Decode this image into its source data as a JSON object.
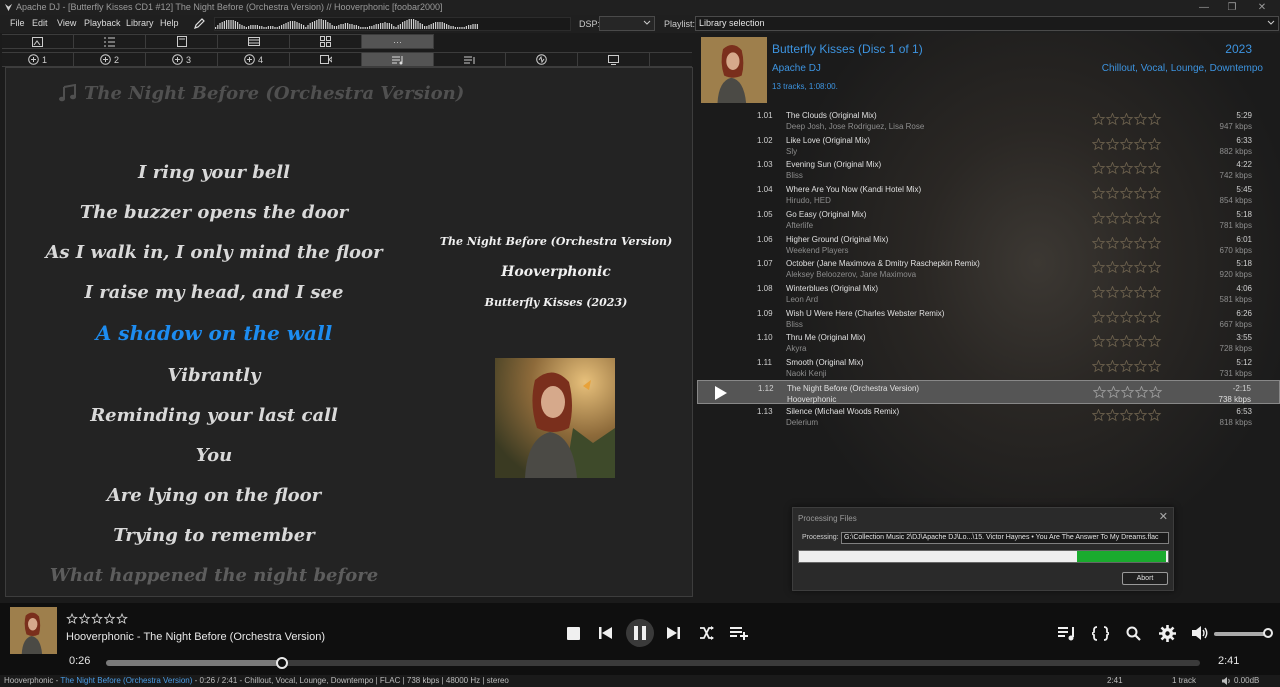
{
  "window": {
    "title": "Apache DJ - [Butterfly Kisses CD1 #12] The Night Before (Orchestra Version) // Hooverphonic  [foobar2000]"
  },
  "menu": [
    "File",
    "Edit",
    "View",
    "Playback",
    "Library",
    "Help"
  ],
  "toolbar": {
    "dsp_label": "DSP:",
    "dsp_value": "",
    "playlist_label": "Playlist:",
    "playlist_value": "Library selection"
  },
  "top_tabs": [
    "image-icon",
    "list-icon",
    "document-icon",
    "grid-list-icon",
    "thumbnails-icon",
    "ellipsis-icon"
  ],
  "second_tabs": [
    {
      "label": "1",
      "icon": "plus-circle-icon"
    },
    {
      "label": "2",
      "icon": "plus-circle-icon"
    },
    {
      "label": "3",
      "icon": "plus-circle-icon"
    },
    {
      "label": "4",
      "icon": "plus-circle-icon"
    },
    {
      "label": "",
      "icon": "video-icon"
    },
    {
      "label": "",
      "icon": "lyrics-icon"
    },
    {
      "label": "",
      "icon": "playlist-icon"
    },
    {
      "label": "",
      "icon": "spectrum-icon"
    },
    {
      "label": "",
      "icon": "monitor-icon"
    }
  ],
  "lyrics": {
    "song_title": "The Night Before (Orchestra Version)",
    "lines": [
      "I ring your bell",
      "The buzzer opens the door",
      "As I walk in, I only mind the floor",
      "I raise my head, and I see",
      "A shadow on the wall",
      "Vibrantly",
      "Reminding your last call",
      "You",
      "Are lying on the floor",
      "Trying to remember",
      "What happened the night before"
    ],
    "current_index": 4
  },
  "now_playing_info": {
    "title": "The Night Before (Orchestra Version)",
    "artist": "Hooverphonic",
    "album": "Butterfly Kisses (2023)"
  },
  "album": {
    "title": "Butterfly Kisses (Disc 1 of 1)",
    "year": "2023",
    "artist": "Apache DJ",
    "genres": "Chillout, Vocal, Lounge, Downtempo",
    "info": "13 tracks, 1:08:00."
  },
  "tracks": [
    {
      "num": "1.01",
      "title": "The Clouds (Original Mix)",
      "artist": "Deep Josh, Jose Rodriguez, Lisa Rose",
      "duration": "5:29",
      "bitrate": "947 kbps"
    },
    {
      "num": "1.02",
      "title": "Like Love (Original Mix)",
      "artist": "Sly",
      "duration": "6:33",
      "bitrate": "882 kbps"
    },
    {
      "num": "1.03",
      "title": "Evening Sun (Original Mix)",
      "artist": "Bliss",
      "duration": "4:22",
      "bitrate": "742 kbps"
    },
    {
      "num": "1.04",
      "title": "Where Are You Now (Kandi Hotel Mix)",
      "artist": "Hirudo, HED",
      "duration": "5:45",
      "bitrate": "854 kbps"
    },
    {
      "num": "1.05",
      "title": "Go Easy (Original Mix)",
      "artist": "Afterlife",
      "duration": "5:18",
      "bitrate": "781 kbps"
    },
    {
      "num": "1.06",
      "title": "Higher Ground (Original Mix)",
      "artist": "Weekend Players",
      "duration": "6:01",
      "bitrate": "670 kbps"
    },
    {
      "num": "1.07",
      "title": "October (Jane Maximova & Dmitry Raschepkin Remix)",
      "artist": "Aleksey Beloozerov, Jane Maximova",
      "duration": "5:18",
      "bitrate": "920 kbps"
    },
    {
      "num": "1.08",
      "title": "Winterblues (Original Mix)",
      "artist": "Leon Ard",
      "duration": "4:06",
      "bitrate": "581 kbps"
    },
    {
      "num": "1.09",
      "title": "Wish U Were Here (Charles Webster Remix)",
      "artist": "Bliss",
      "duration": "6:26",
      "bitrate": "667 kbps"
    },
    {
      "num": "1.10",
      "title": "Thru Me (Original Mix)",
      "artist": "Akyra",
      "duration": "3:55",
      "bitrate": "728 kbps"
    },
    {
      "num": "1.11",
      "title": "Smooth (Original Mix)",
      "artist": "Naoki Kenji",
      "duration": "5:12",
      "bitrate": "731 kbps"
    },
    {
      "num": "1.12",
      "title": "The Night Before (Orchestra Version)",
      "artist": "Hooverphonic",
      "duration": "-2:15",
      "bitrate": "738 kbps",
      "playing": true
    },
    {
      "num": "1.13",
      "title": "Silence (Michael Woods Remix)",
      "artist": "Delerium",
      "duration": "6:53",
      "bitrate": "818 kbps"
    }
  ],
  "dialog": {
    "title": "Processing Files",
    "label": "Processing:",
    "path": "G:\\Collection Music 2\\DJ\\Apache DJ\\Lo...\\15. Victor Haynes • You Are The Answer To My Dreams.flac",
    "progress": 0.76,
    "abort_label": "Abort"
  },
  "transport": {
    "now_playing": "Hooverphonic - The Night Before (Orchestra Version)",
    "elapsed": "0:26",
    "total": "2:41",
    "position": 0.161,
    "volume": 1.0,
    "rating": 0
  },
  "status": {
    "artist": "Hooverphonic - ",
    "title": "The Night Before (Orchestra Version)",
    "details": " - 0:26 / 2:41 - Chillout, Vocal, Lounge, Downtempo | FLAC | 738 kbps | 48000 Hz | stereo",
    "length": "2:41",
    "track_count": "1 track",
    "volume": "0.00dB"
  },
  "colors": {
    "accent": "#1d8cf0",
    "album_text": "#3d94e0",
    "progress_green": "#1aab2e"
  }
}
